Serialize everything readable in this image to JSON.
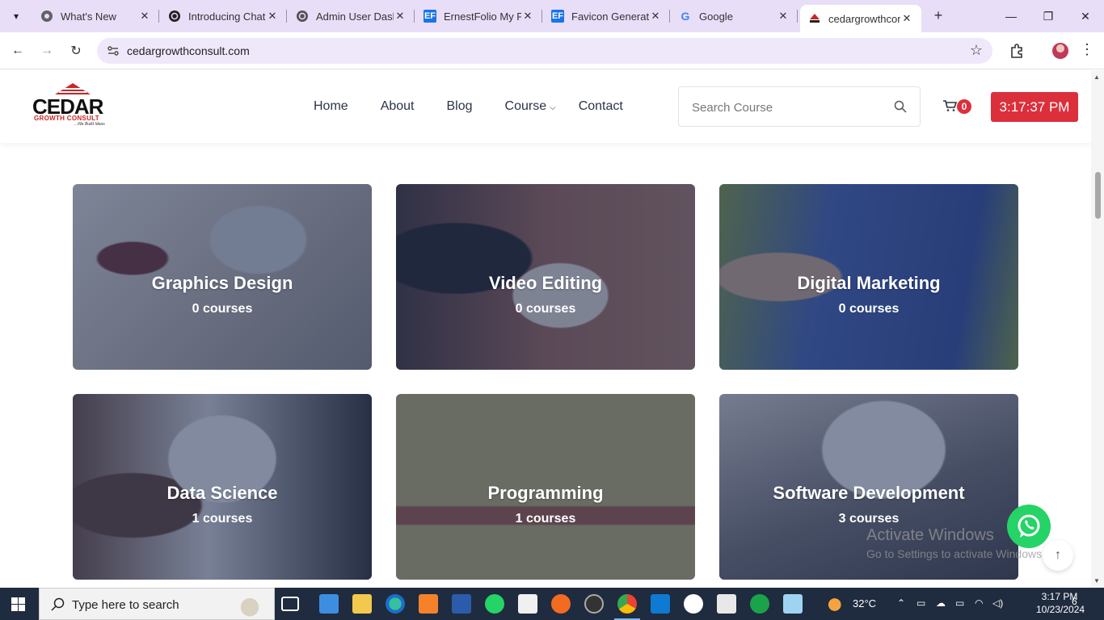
{
  "browser": {
    "tabs": [
      {
        "title": "What's New",
        "favicon": "chrome-icon"
      },
      {
        "title": "Introducing ChatGPT",
        "favicon": "openai-icon"
      },
      {
        "title": "Admin User Dashboard",
        "favicon": "openai-icon"
      },
      {
        "title": "ErnestFolio My Portfolio",
        "favicon": "ef-icon"
      },
      {
        "title": "Favicon Generator",
        "favicon": "ef-icon"
      },
      {
        "title": "Google",
        "favicon": "google-icon"
      },
      {
        "title": "cedargrowthconsult",
        "favicon": "cedar-icon"
      }
    ],
    "url": "cedargrowthconsult.com"
  },
  "site": {
    "logo": {
      "name": "CEDAR",
      "subtitle": "GROWTH CONSULT",
      "tagline": "...We Build Ideas"
    },
    "nav": [
      {
        "label": "Home"
      },
      {
        "label": "About"
      },
      {
        "label": "Blog"
      },
      {
        "label": "Course"
      },
      {
        "label": "Contact"
      }
    ],
    "search": {
      "placeholder": "Search Course"
    },
    "cart_count": "0",
    "clock": "3:17:37 PM"
  },
  "categories": [
    {
      "title": "Graphics Design",
      "count": "0 courses"
    },
    {
      "title": "Video Editing",
      "count": "0 courses"
    },
    {
      "title": "Digital Marketing",
      "count": "0 courses"
    },
    {
      "title": "Data Science",
      "count": "1 courses"
    },
    {
      "title": "Programming",
      "count": "1 courses"
    },
    {
      "title": "Software Development",
      "count": "3 courses"
    }
  ],
  "watermark": {
    "line1": "Activate Windows",
    "line2": "Go to Settings to activate Windows."
  },
  "taskbar": {
    "search_placeholder": "Type here to search",
    "temperature": "32°C",
    "time": "3:17 PM",
    "date": "10/23/2024",
    "notifications": "6"
  },
  "colors": {
    "accent": "#dc2f3c",
    "overlay": "#26345c",
    "taskbar": "#1f2b3e",
    "tabbar": "#e8def8"
  }
}
